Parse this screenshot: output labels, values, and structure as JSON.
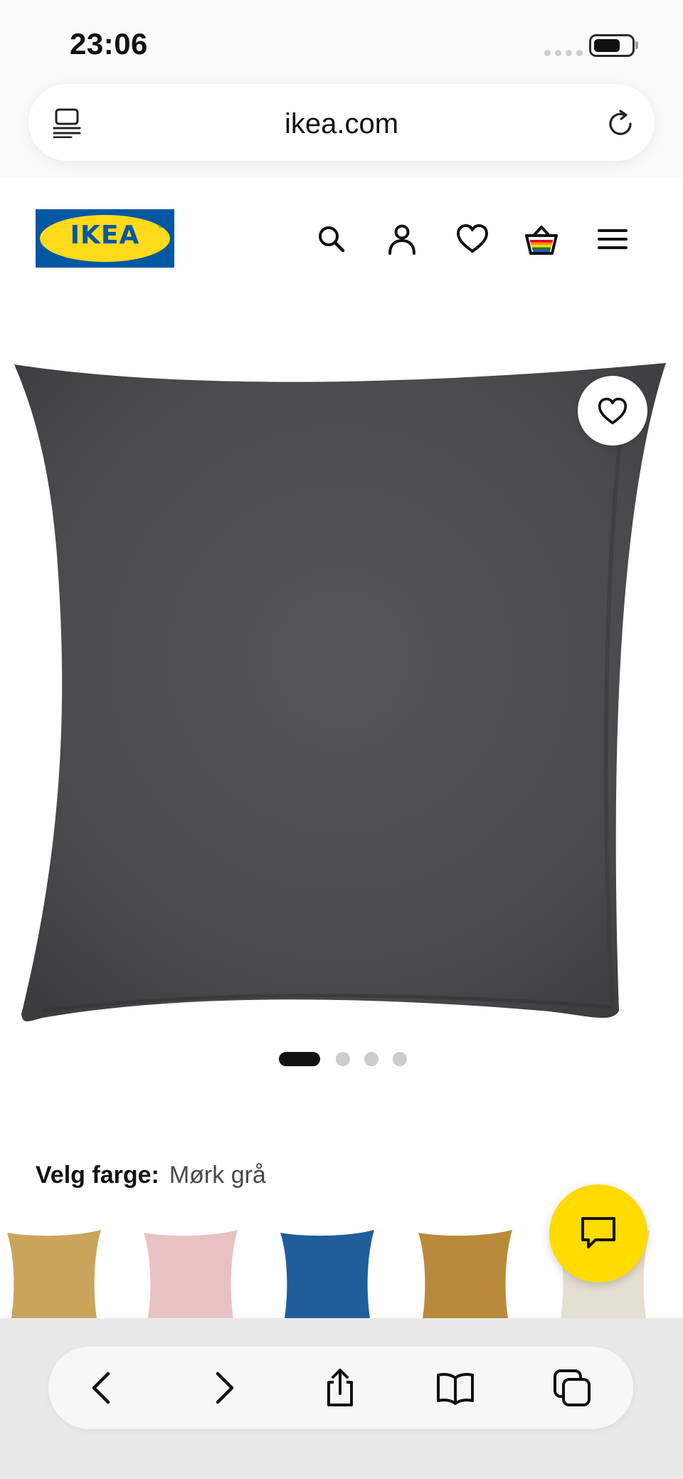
{
  "status_bar": {
    "time": "23:06",
    "battery_level": 0.7
  },
  "browser": {
    "url": "ikea.com"
  },
  "site": {
    "logo_text": "IKEA",
    "nav_icons": [
      "search-icon",
      "account-icon",
      "favourites-icon",
      "cart-icon",
      "menu-icon"
    ]
  },
  "product": {
    "image_count": 4,
    "active_image": 1,
    "color_label": "Velg farge:",
    "selected_color": "Mørk grå",
    "pillow_color": "#4b4b4d",
    "swatches": [
      {
        "color": "#c9a55c"
      },
      {
        "color": "#e8c2c3"
      },
      {
        "color": "#1f5e9b"
      },
      {
        "color": "#b98a3a"
      },
      {
        "color": "#e5ded2"
      }
    ]
  },
  "chat": {
    "icon": "chat-icon",
    "color": "#ffdb00"
  },
  "toolbar": {
    "icons": [
      "back-icon",
      "forward-icon",
      "share-icon",
      "bookmarks-icon",
      "tabs-icon"
    ]
  },
  "brand_colors": {
    "ikea_blue": "#0058a3",
    "ikea_yellow": "#ffda1a"
  }
}
